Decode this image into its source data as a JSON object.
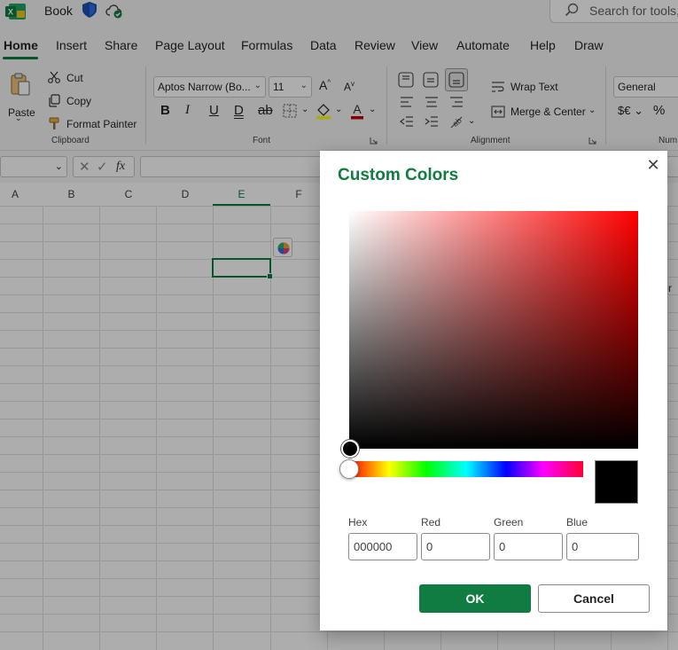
{
  "titlebar": {
    "book_title": "Book",
    "search_placeholder": "Search for tools,"
  },
  "tabs": [
    "Home",
    "Insert",
    "Share",
    "Page Layout",
    "Formulas",
    "Data",
    "Review",
    "View",
    "Automate",
    "Help",
    "Draw"
  ],
  "active_tab": "Home",
  "ribbon": {
    "clipboard": {
      "paste": "Paste",
      "cut": "Cut",
      "copy": "Copy",
      "format_painter": "Format Painter",
      "group_label": "Clipboard"
    },
    "font": {
      "font_name": "Aptos Narrow (Bo...",
      "font_size": "11",
      "group_label": "Font"
    },
    "alignment": {
      "wrap_text": "Wrap Text",
      "merge_center": "Merge & Center",
      "group_label": "Alignment"
    },
    "number": {
      "format": "General",
      "group_label": "Num"
    }
  },
  "grid": {
    "columns": [
      "A",
      "B",
      "C",
      "D",
      "E",
      "F"
    ],
    "selected_column": "E",
    "edge_text": "r"
  },
  "dialog": {
    "title": "Custom Colors",
    "hex_label": "Hex",
    "hex_value": "000000",
    "red_label": "Red",
    "red_value": "0",
    "green_label": "Green",
    "green_value": "0",
    "blue_label": "Blue",
    "blue_value": "0",
    "ok_label": "OK",
    "cancel_label": "Cancel",
    "selected_color": "#000000",
    "base_hue_color": "#ff0000"
  },
  "colors": {
    "accent": "#107c41",
    "font_color_bar": "#c00000",
    "fill_color_bar": "#ffff00"
  }
}
